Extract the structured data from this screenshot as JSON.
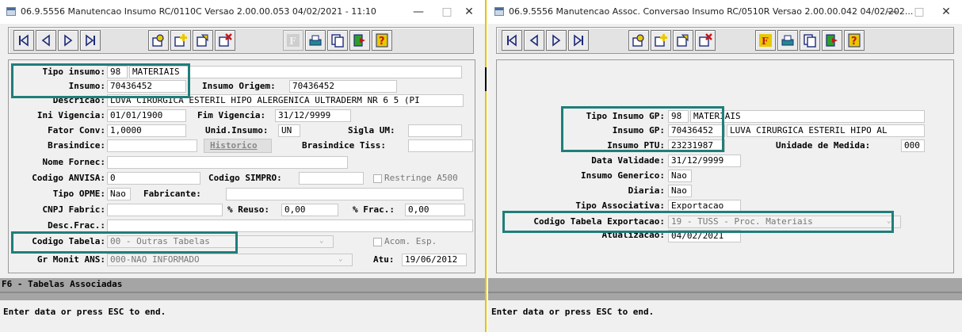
{
  "window1": {
    "title": "06.9.5556 Manutencao  Insumo RC/0110C Versao 2.00.00.053 04/02/2021 - 11:10",
    "tipo_insumo_label": "Tipo insumo:",
    "tipo_insumo_code": "98",
    "tipo_insumo_desc": "MATERIAIS",
    "insumo_label": "Insumo:",
    "insumo_value": "70436452",
    "insumo_origem_label": "Insumo Origem:",
    "insumo_origem_value": "70436452",
    "descricao_label": "Descricao:",
    "descricao_value": "LUVA CIRURGICA ESTERIL HIPO ALERGENICA ULTRADERM NR 6 5 (PI",
    "ini_vigencia_label": "Ini Vigencia:",
    "ini_vigencia_value": "01/01/1900",
    "fim_vigencia_label": "Fim Vigencia:",
    "fim_vigencia_value": "31/12/9999",
    "fator_conv_label": "Fator Conv:",
    "fator_conv_value": "1,0000",
    "unid_insumo_label": "Unid.Insumo:",
    "unid_insumo_value": "UN",
    "sigla_um_label": "Sigla UM:",
    "sigla_um_value": "",
    "brasindice_label": "Brasindice:",
    "brasindice_value": "",
    "historico_label": "Historico",
    "brasindice_tiss_label": "Brasindice Tiss:",
    "brasindice_tiss_value": "",
    "nome_fornec_label": "Nome Fornec:",
    "nome_fornec_value": "",
    "codigo_anvisa_label": "Codigo ANVISA:",
    "codigo_anvisa_value": "0",
    "codigo_simpro_label": "Codigo SIMPRO:",
    "codigo_simpro_value": "",
    "restringe_label": "Restringe A500",
    "tipo_opme_label": "Tipo OPME:",
    "tipo_opme_value": "Nao",
    "fabricante_label": "Fabricante:",
    "fabricante_value": "",
    "cnpj_label": "CNPJ Fabric:",
    "cnpj_value": "",
    "reuso_label": "% Reuso:",
    "reuso_value": "0,00",
    "frac_label": "% Frac.:",
    "frac_value": "0,00",
    "desc_frac_label": "Desc.Frac.:",
    "desc_frac_value": "",
    "codigo_tabela_label": "Codigo Tabela:",
    "codigo_tabela_value": "00 - Outras Tabelas",
    "acom_esp_label": "Acom. Esp.",
    "gr_monit_label": "Gr Monit ANS:",
    "gr_monit_value": "000-NAO INFORMADO",
    "atu_label": "Atu:",
    "atu_value": "19/06/2012",
    "band_text": "F6 - Tabelas Associadas",
    "status_text": "Enter data or press ESC to end."
  },
  "window2": {
    "title": "06.9.5556 Manutencao  Assoc. Conversao Insumo RC/0510R Versao 2.00.00.042 04/02/202...",
    "tipo_insumo_gp_label": "Tipo Insumo GP:",
    "tipo_insumo_gp_code": "98",
    "tipo_insumo_gp_desc": "MATERIAIS",
    "insumo_gp_label": "Insumo GP:",
    "insumo_gp_value": "70436452",
    "insumo_gp_desc": "LUVA CIRURGICA ESTERIL HIPO AL",
    "insumo_ptu_label": "Insumo PTU:",
    "insumo_ptu_value": "23231987",
    "unidade_medida_label": "Unidade de Medida:",
    "unidade_medida_value": "000",
    "data_validade_label": "Data Validade:",
    "data_validade_value": "31/12/9999",
    "insumo_generico_label": "Insumo Generico:",
    "insumo_generico_value": "Nao",
    "diaria_label": "Diaria:",
    "diaria_value": "Nao",
    "tipo_assoc_label": "Tipo Associativa:",
    "tipo_assoc_value": "Exportacao",
    "codigo_tabela_exp_label": "Codigo Tabela Exportacao:",
    "codigo_tabela_exp_value": "19 - TUSS - Proc. Materiais",
    "atualizacao_label": "Atualizacao:",
    "atualizacao_value": "04/02/2021",
    "status_text": "Enter data or press ESC to end."
  },
  "window_controls": {
    "minimize": "—",
    "maximize": "□",
    "close": "✕"
  },
  "toolbar_icons": [
    "first-record-icon",
    "previous-record-icon",
    "next-record-icon",
    "last-record-icon",
    "search-icon",
    "add-record-icon",
    "edit-record-icon",
    "delete-record-icon",
    "filter-icon",
    "print-icon",
    "copy-icon",
    "exit-icon",
    "help-icon"
  ],
  "colors": {
    "highlight": "#1f7e7a",
    "band": "#a5a5a5",
    "window_bg": "#f0f0f0",
    "navy_icon": "#1e2a78",
    "yellow_icon": "#e8c800"
  }
}
